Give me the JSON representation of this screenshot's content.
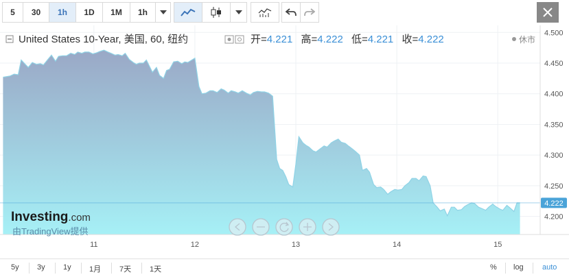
{
  "toolbar": {
    "intervals": [
      "5",
      "30",
      "1h",
      "1D",
      "1M"
    ],
    "active_interval": "1h",
    "interval_dropdown_label": "1h"
  },
  "legend": {
    "title": "United States 10-Year, 美国, 60, 纽约",
    "open_label": "开=",
    "open_value": "4.221",
    "high_label": "高=",
    "high_value": "4.222",
    "low_label": "低=",
    "low_value": "4.221",
    "close_label": "收=",
    "close_value": "4.222",
    "market_status": "休市"
  },
  "watermark": {
    "brand": "Investing",
    "brand_suffix": ".com",
    "provided_by": "由TradingView提供"
  },
  "bottombar": {
    "ranges": [
      "5y",
      "3y",
      "1y",
      "1月",
      "7天",
      "1天"
    ],
    "percent_label": "%",
    "log_label": "log",
    "auto_label": "auto"
  },
  "colors": {
    "area_top": "#9aa8c6",
    "area_bottom": "#a6f0f6",
    "line": "#8fd3e6",
    "price_tag": "#4aa3d8",
    "value_text": "#3a8fd6"
  },
  "chart_data": {
    "type": "area",
    "title": "United States 10-Year, 美国, 60, 纽约",
    "xlabel": "",
    "ylabel": "",
    "x_tick_labels": [
      "11",
      "12",
      "13",
      "14",
      "15"
    ],
    "x_ticks": [
      10.93,
      11.93,
      12.93,
      13.93,
      14.93
    ],
    "xlim": [
      10.0,
      15.35
    ],
    "ylim": [
      4.1705,
      4.5115
    ],
    "y_tick_labels": [
      "4.500",
      "4.450",
      "4.400",
      "4.350",
      "4.300",
      "4.250",
      "4.200"
    ],
    "y_ticks": [
      4.5,
      4.45,
      4.4,
      4.35,
      4.3,
      4.25,
      4.2
    ],
    "last_price": 4.222,
    "last_price_label": "4.222",
    "grid": true,
    "legend": "top-left",
    "series": [
      {
        "x": [
          10.03,
          10.1,
          10.14,
          10.18,
          10.21,
          10.25,
          10.28,
          10.32,
          10.36,
          10.4,
          10.43,
          10.47,
          10.51,
          10.55,
          10.58,
          10.62,
          10.66,
          10.7,
          10.74,
          10.77,
          10.81,
          10.84,
          10.88,
          10.92,
          10.96,
          10.99,
          11.03,
          11.07,
          11.1,
          11.14,
          11.17,
          11.21,
          11.24,
          11.28,
          11.32,
          11.35,
          11.38,
          11.42,
          11.45,
          11.48,
          11.51,
          11.55,
          11.58,
          11.62,
          11.65,
          11.68,
          11.72,
          11.76,
          11.8,
          11.83,
          11.86,
          11.9,
          11.93,
          11.97,
          12.0,
          12.04,
          12.08,
          12.11,
          12.15,
          12.19,
          12.22,
          12.26,
          12.29,
          12.33,
          12.36,
          12.4,
          12.44,
          12.48,
          12.51,
          12.55,
          12.59,
          12.62,
          12.66,
          12.7,
          12.74,
          12.77,
          12.8,
          12.83,
          12.86,
          12.9,
          12.93,
          12.96,
          13.0,
          13.03,
          13.06,
          13.1,
          13.13,
          13.17,
          13.21,
          13.24,
          13.28,
          13.31,
          13.35,
          13.38,
          13.42,
          13.45,
          13.49,
          13.52,
          13.56,
          13.59,
          13.63,
          13.66,
          13.7,
          13.73,
          13.77,
          13.8,
          13.84,
          13.87,
          13.91,
          13.94,
          13.98,
          14.01,
          14.05,
          14.08,
          14.12,
          14.15,
          14.19,
          14.22,
          14.26,
          14.29,
          14.33,
          14.36,
          14.4,
          14.43,
          14.47,
          14.5,
          14.53,
          14.57,
          14.6,
          14.63,
          14.67,
          14.7,
          14.74,
          14.77,
          14.81,
          14.84,
          14.88,
          14.91,
          14.95,
          14.98,
          15.02,
          15.05,
          15.09,
          15.12,
          15.15
        ],
        "y": [
          4.427,
          4.429,
          4.432,
          4.431,
          4.455,
          4.448,
          4.443,
          4.451,
          4.448,
          4.449,
          4.447,
          4.455,
          4.463,
          4.453,
          4.461,
          4.462,
          4.462,
          4.466,
          4.464,
          4.468,
          4.466,
          4.468,
          4.468,
          4.465,
          4.467,
          4.469,
          4.471,
          4.468,
          4.466,
          4.463,
          4.464,
          4.462,
          4.466,
          4.456,
          4.451,
          4.448,
          4.45,
          4.45,
          4.455,
          4.445,
          4.435,
          4.443,
          4.43,
          4.425,
          4.438,
          4.44,
          4.452,
          4.453,
          4.449,
          4.452,
          4.451,
          4.455,
          4.458,
          4.412,
          4.4,
          4.401,
          4.405,
          4.405,
          4.402,
          4.408,
          4.406,
          4.401,
          4.405,
          4.403,
          4.401,
          4.405,
          4.401,
          4.398,
          4.402,
          4.404,
          4.403,
          4.403,
          4.401,
          4.396,
          4.293,
          4.278,
          4.275,
          4.265,
          4.252,
          4.248,
          4.285,
          4.33,
          4.32,
          4.316,
          4.313,
          4.307,
          4.305,
          4.31,
          4.315,
          4.313,
          4.32,
          4.323,
          4.326,
          4.321,
          4.319,
          4.315,
          4.31,
          4.306,
          4.3,
          4.275,
          4.278,
          4.272,
          4.252,
          4.247,
          4.248,
          4.244,
          4.236,
          4.24,
          4.244,
          4.243,
          4.244,
          4.25,
          4.255,
          4.262,
          4.262,
          4.258,
          4.266,
          4.265,
          4.25,
          4.222,
          4.215,
          4.209,
          4.212,
          4.201,
          4.215,
          4.215,
          4.21,
          4.211,
          4.216,
          4.219,
          4.222,
          4.221,
          4.215,
          4.213,
          4.21,
          4.215,
          4.22,
          4.216,
          4.212,
          4.21,
          4.218,
          4.214,
          4.208,
          4.222,
          4.222
        ]
      }
    ]
  }
}
